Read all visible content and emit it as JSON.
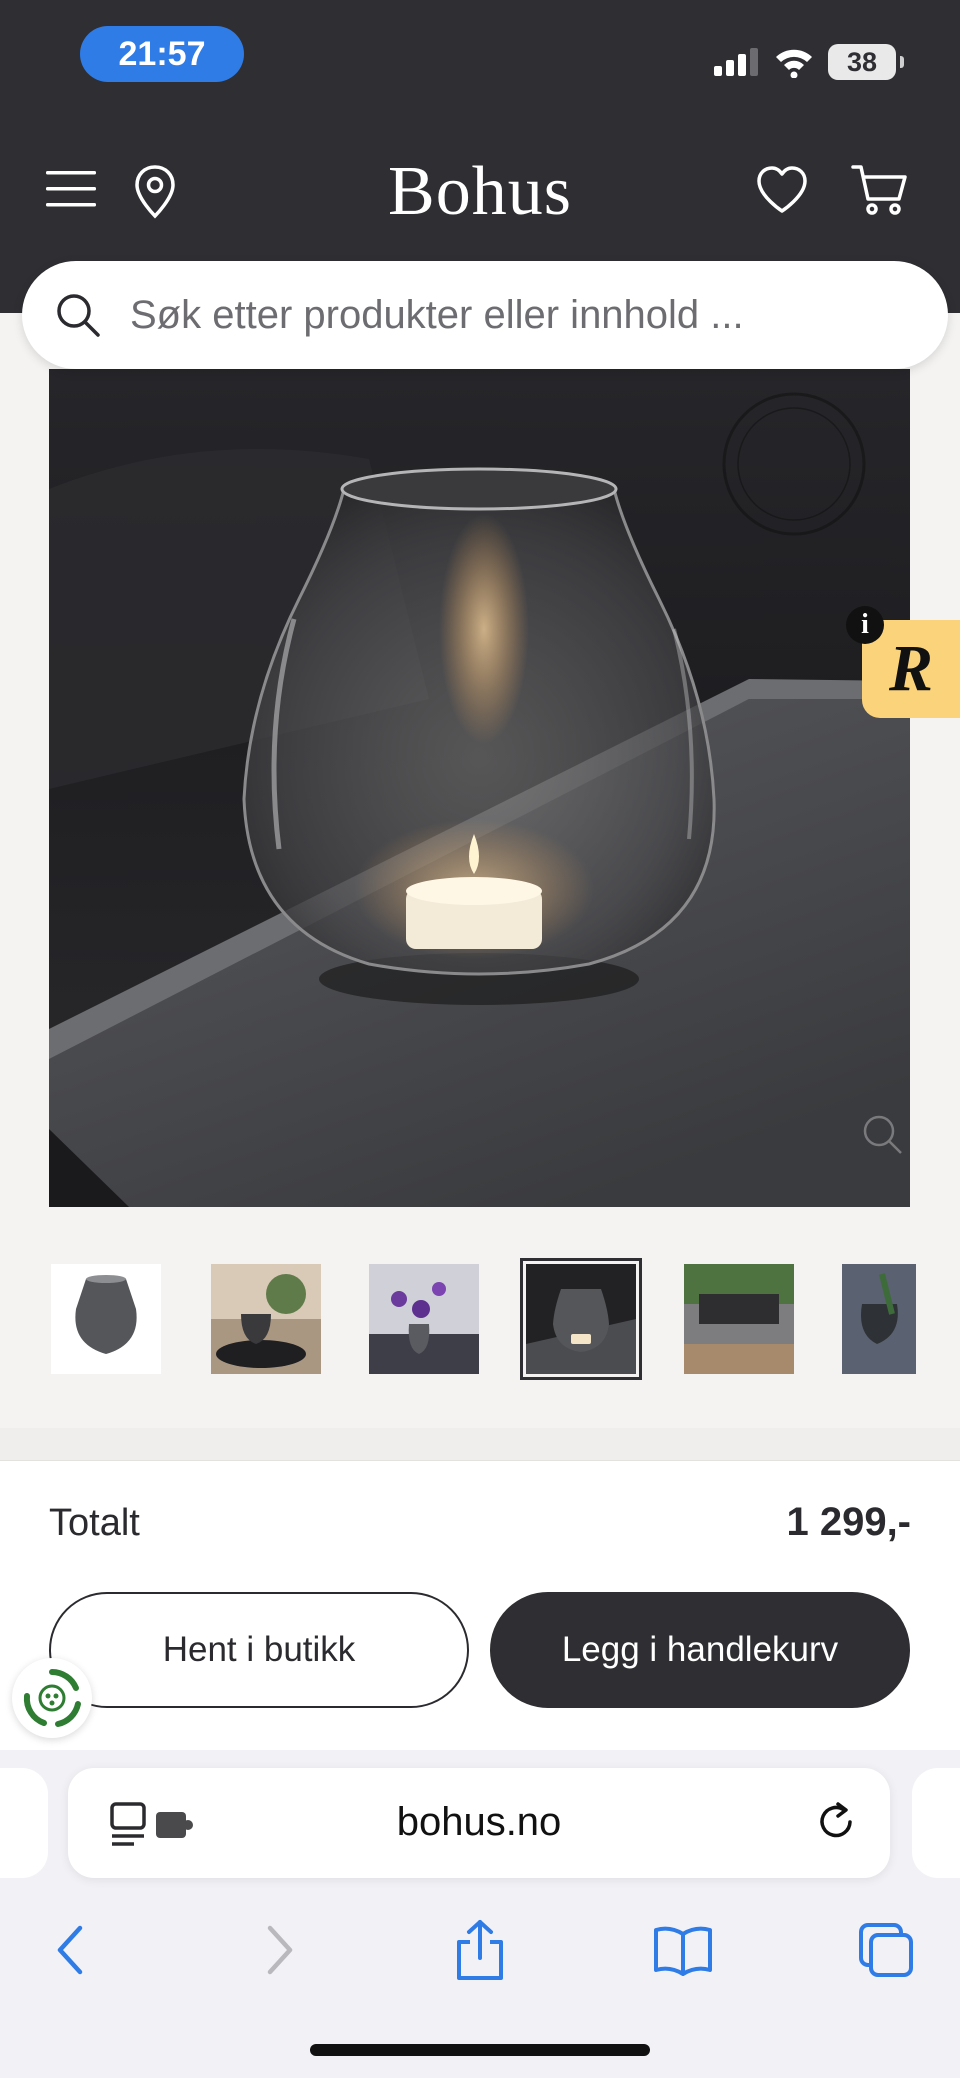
{
  "status_bar": {
    "time": "21:57",
    "battery": "38"
  },
  "header": {
    "brand": "Bohus",
    "icons": [
      "menu-icon",
      "location-pin-icon",
      "heart-icon",
      "cart-icon"
    ]
  },
  "search": {
    "placeholder": "Søk etter produkter eller innhold ..."
  },
  "product_image": {
    "alt": "Glass lantern with tealight candle",
    "badge_text": "R",
    "info": "i"
  },
  "thumbnails": {
    "count": 6,
    "selected_index": 3
  },
  "summary": {
    "total_label": "Totalt",
    "total_price": "1 299,-"
  },
  "actions": {
    "pickup_label": "Hent i butikk",
    "add_to_cart_label": "Legg i handlekurv"
  },
  "browser": {
    "url": "bohus.no"
  },
  "colors": {
    "header_bg": "#2f2f33",
    "badge_yellow": "#fbd37a",
    "ios_blue": "#2f7ce6",
    "eco_green": "#2e7d32"
  }
}
